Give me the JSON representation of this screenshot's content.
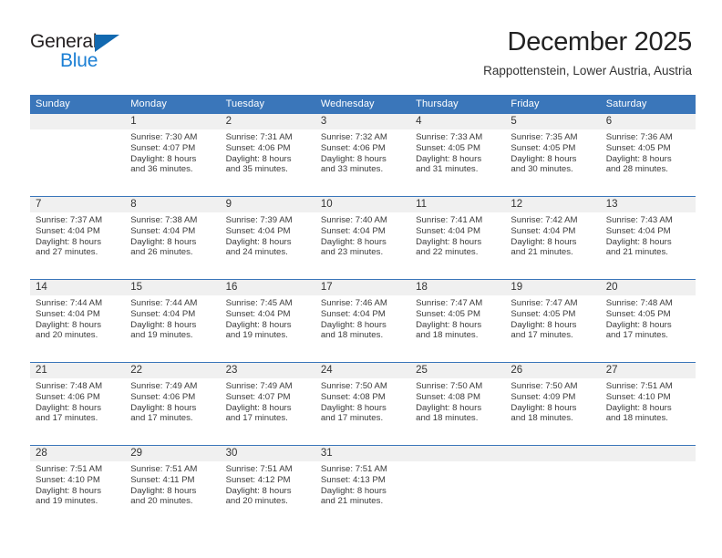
{
  "logo": {
    "text_primary": "General",
    "text_secondary": "Blue",
    "icon": "triangle-icon",
    "color_primary": "#231f20",
    "color_secondary": "#1b7fd4",
    "color_triangle": "#1269b0"
  },
  "header": {
    "title": "December 2025",
    "subtitle": "Rappottenstein, Lower Austria, Austria"
  },
  "theme": {
    "header_row_bg": "#3a76ba",
    "header_row_text": "#ffffff",
    "daynum_bg": "#f0f0f0",
    "row_divider": "#3a76ba",
    "body_text": "#3b3b3b"
  },
  "weekday_headers": [
    "Sunday",
    "Monday",
    "Tuesday",
    "Wednesday",
    "Thursday",
    "Friday",
    "Saturday"
  ],
  "weeks": [
    [
      {
        "day": "",
        "empty": true,
        "sunrise": "",
        "sunset": "",
        "daylight1": "",
        "daylight2": ""
      },
      {
        "day": "1",
        "empty": false,
        "sunrise": "Sunrise: 7:30 AM",
        "sunset": "Sunset: 4:07 PM",
        "daylight1": "Daylight: 8 hours",
        "daylight2": "and 36 minutes."
      },
      {
        "day": "2",
        "empty": false,
        "sunrise": "Sunrise: 7:31 AM",
        "sunset": "Sunset: 4:06 PM",
        "daylight1": "Daylight: 8 hours",
        "daylight2": "and 35 minutes."
      },
      {
        "day": "3",
        "empty": false,
        "sunrise": "Sunrise: 7:32 AM",
        "sunset": "Sunset: 4:06 PM",
        "daylight1": "Daylight: 8 hours",
        "daylight2": "and 33 minutes."
      },
      {
        "day": "4",
        "empty": false,
        "sunrise": "Sunrise: 7:33 AM",
        "sunset": "Sunset: 4:05 PM",
        "daylight1": "Daylight: 8 hours",
        "daylight2": "and 31 minutes."
      },
      {
        "day": "5",
        "empty": false,
        "sunrise": "Sunrise: 7:35 AM",
        "sunset": "Sunset: 4:05 PM",
        "daylight1": "Daylight: 8 hours",
        "daylight2": "and 30 minutes."
      },
      {
        "day": "6",
        "empty": false,
        "sunrise": "Sunrise: 7:36 AM",
        "sunset": "Sunset: 4:05 PM",
        "daylight1": "Daylight: 8 hours",
        "daylight2": "and 28 minutes."
      }
    ],
    [
      {
        "day": "7",
        "empty": false,
        "sunrise": "Sunrise: 7:37 AM",
        "sunset": "Sunset: 4:04 PM",
        "daylight1": "Daylight: 8 hours",
        "daylight2": "and 27 minutes."
      },
      {
        "day": "8",
        "empty": false,
        "sunrise": "Sunrise: 7:38 AM",
        "sunset": "Sunset: 4:04 PM",
        "daylight1": "Daylight: 8 hours",
        "daylight2": "and 26 minutes."
      },
      {
        "day": "9",
        "empty": false,
        "sunrise": "Sunrise: 7:39 AM",
        "sunset": "Sunset: 4:04 PM",
        "daylight1": "Daylight: 8 hours",
        "daylight2": "and 24 minutes."
      },
      {
        "day": "10",
        "empty": false,
        "sunrise": "Sunrise: 7:40 AM",
        "sunset": "Sunset: 4:04 PM",
        "daylight1": "Daylight: 8 hours",
        "daylight2": "and 23 minutes."
      },
      {
        "day": "11",
        "empty": false,
        "sunrise": "Sunrise: 7:41 AM",
        "sunset": "Sunset: 4:04 PM",
        "daylight1": "Daylight: 8 hours",
        "daylight2": "and 22 minutes."
      },
      {
        "day": "12",
        "empty": false,
        "sunrise": "Sunrise: 7:42 AM",
        "sunset": "Sunset: 4:04 PM",
        "daylight1": "Daylight: 8 hours",
        "daylight2": "and 21 minutes."
      },
      {
        "day": "13",
        "empty": false,
        "sunrise": "Sunrise: 7:43 AM",
        "sunset": "Sunset: 4:04 PM",
        "daylight1": "Daylight: 8 hours",
        "daylight2": "and 21 minutes."
      }
    ],
    [
      {
        "day": "14",
        "empty": false,
        "sunrise": "Sunrise: 7:44 AM",
        "sunset": "Sunset: 4:04 PM",
        "daylight1": "Daylight: 8 hours",
        "daylight2": "and 20 minutes."
      },
      {
        "day": "15",
        "empty": false,
        "sunrise": "Sunrise: 7:44 AM",
        "sunset": "Sunset: 4:04 PM",
        "daylight1": "Daylight: 8 hours",
        "daylight2": "and 19 minutes."
      },
      {
        "day": "16",
        "empty": false,
        "sunrise": "Sunrise: 7:45 AM",
        "sunset": "Sunset: 4:04 PM",
        "daylight1": "Daylight: 8 hours",
        "daylight2": "and 19 minutes."
      },
      {
        "day": "17",
        "empty": false,
        "sunrise": "Sunrise: 7:46 AM",
        "sunset": "Sunset: 4:04 PM",
        "daylight1": "Daylight: 8 hours",
        "daylight2": "and 18 minutes."
      },
      {
        "day": "18",
        "empty": false,
        "sunrise": "Sunrise: 7:47 AM",
        "sunset": "Sunset: 4:05 PM",
        "daylight1": "Daylight: 8 hours",
        "daylight2": "and 18 minutes."
      },
      {
        "day": "19",
        "empty": false,
        "sunrise": "Sunrise: 7:47 AM",
        "sunset": "Sunset: 4:05 PM",
        "daylight1": "Daylight: 8 hours",
        "daylight2": "and 17 minutes."
      },
      {
        "day": "20",
        "empty": false,
        "sunrise": "Sunrise: 7:48 AM",
        "sunset": "Sunset: 4:05 PM",
        "daylight1": "Daylight: 8 hours",
        "daylight2": "and 17 minutes."
      }
    ],
    [
      {
        "day": "21",
        "empty": false,
        "sunrise": "Sunrise: 7:48 AM",
        "sunset": "Sunset: 4:06 PM",
        "daylight1": "Daylight: 8 hours",
        "daylight2": "and 17 minutes."
      },
      {
        "day": "22",
        "empty": false,
        "sunrise": "Sunrise: 7:49 AM",
        "sunset": "Sunset: 4:06 PM",
        "daylight1": "Daylight: 8 hours",
        "daylight2": "and 17 minutes."
      },
      {
        "day": "23",
        "empty": false,
        "sunrise": "Sunrise: 7:49 AM",
        "sunset": "Sunset: 4:07 PM",
        "daylight1": "Daylight: 8 hours",
        "daylight2": "and 17 minutes."
      },
      {
        "day": "24",
        "empty": false,
        "sunrise": "Sunrise: 7:50 AM",
        "sunset": "Sunset: 4:08 PM",
        "daylight1": "Daylight: 8 hours",
        "daylight2": "and 17 minutes."
      },
      {
        "day": "25",
        "empty": false,
        "sunrise": "Sunrise: 7:50 AM",
        "sunset": "Sunset: 4:08 PM",
        "daylight1": "Daylight: 8 hours",
        "daylight2": "and 18 minutes."
      },
      {
        "day": "26",
        "empty": false,
        "sunrise": "Sunrise: 7:50 AM",
        "sunset": "Sunset: 4:09 PM",
        "daylight1": "Daylight: 8 hours",
        "daylight2": "and 18 minutes."
      },
      {
        "day": "27",
        "empty": false,
        "sunrise": "Sunrise: 7:51 AM",
        "sunset": "Sunset: 4:10 PM",
        "daylight1": "Daylight: 8 hours",
        "daylight2": "and 18 minutes."
      }
    ],
    [
      {
        "day": "28",
        "empty": false,
        "sunrise": "Sunrise: 7:51 AM",
        "sunset": "Sunset: 4:10 PM",
        "daylight1": "Daylight: 8 hours",
        "daylight2": "and 19 minutes."
      },
      {
        "day": "29",
        "empty": false,
        "sunrise": "Sunrise: 7:51 AM",
        "sunset": "Sunset: 4:11 PM",
        "daylight1": "Daylight: 8 hours",
        "daylight2": "and 20 minutes."
      },
      {
        "day": "30",
        "empty": false,
        "sunrise": "Sunrise: 7:51 AM",
        "sunset": "Sunset: 4:12 PM",
        "daylight1": "Daylight: 8 hours",
        "daylight2": "and 20 minutes."
      },
      {
        "day": "31",
        "empty": false,
        "sunrise": "Sunrise: 7:51 AM",
        "sunset": "Sunset: 4:13 PM",
        "daylight1": "Daylight: 8 hours",
        "daylight2": "and 21 minutes."
      },
      {
        "day": "",
        "empty": true,
        "sunrise": "",
        "sunset": "",
        "daylight1": "",
        "daylight2": ""
      },
      {
        "day": "",
        "empty": true,
        "sunrise": "",
        "sunset": "",
        "daylight1": "",
        "daylight2": ""
      },
      {
        "day": "",
        "empty": true,
        "sunrise": "",
        "sunset": "",
        "daylight1": "",
        "daylight2": ""
      }
    ]
  ]
}
